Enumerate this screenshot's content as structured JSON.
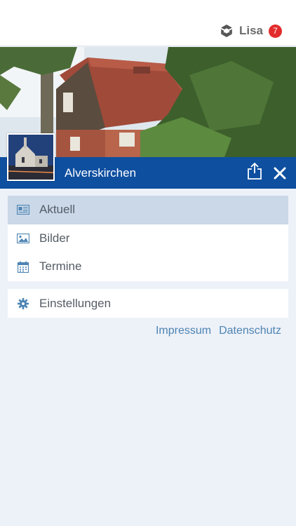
{
  "header": {
    "user_name": "Lisa",
    "badge_count": "7",
    "logo_icon": "app-logo-icon"
  },
  "banner": {
    "title": "Alverskirchen",
    "share_icon": "share-icon",
    "close_icon": "close-icon"
  },
  "menu": {
    "items": [
      {
        "label": "Aktuell",
        "icon": "newspaper-icon",
        "active": true
      },
      {
        "label": "Bilder",
        "icon": "image-icon",
        "active": false
      },
      {
        "label": "Termine",
        "icon": "calendar-icon",
        "active": false
      }
    ],
    "settings": {
      "label": "Einstellungen",
      "icon": "gear-icon"
    }
  },
  "footer_links": {
    "impressum": "Impressum",
    "datenschutz": "Datenschutz"
  },
  "colors": {
    "brand_blue": "#0e4fa0",
    "active_row": "#cad8e8",
    "link": "#4d84b3",
    "badge_red": "#e32b2b",
    "background": "#edf1f8"
  }
}
